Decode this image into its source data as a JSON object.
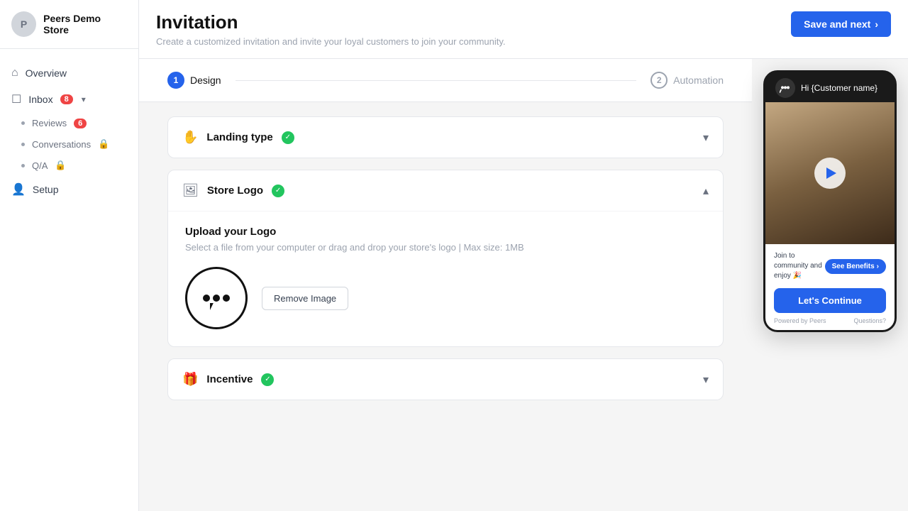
{
  "sidebar": {
    "store_name": "Peers Demo Store",
    "avatar_initials": "P",
    "nav_items": [
      {
        "id": "overview",
        "label": "Overview",
        "icon": "⌂",
        "badge": null,
        "locked": false
      },
      {
        "id": "inbox",
        "label": "Inbox",
        "icon": "☐",
        "badge": "8",
        "locked": false,
        "has_chevron": true
      },
      {
        "id": "reviews",
        "label": "Reviews",
        "icon": "•",
        "badge": "6",
        "locked": false,
        "sub": true
      },
      {
        "id": "conversations",
        "label": "Conversations",
        "icon": "•",
        "badge": null,
        "locked": true,
        "sub": true
      },
      {
        "id": "qa",
        "label": "Q/A",
        "icon": "•",
        "badge": null,
        "locked": true,
        "sub": true
      },
      {
        "id": "setup",
        "label": "Setup",
        "icon": "👤",
        "badge": null,
        "locked": false
      }
    ]
  },
  "header": {
    "title": "Invitation",
    "subtitle": "Create a customized invitation and invite your loyal customers to join your community.",
    "save_next_label": "Save and next",
    "save_next_arrow": "→"
  },
  "steps": [
    {
      "id": "design",
      "label": "Design",
      "number": "1",
      "active": true
    },
    {
      "id": "automation",
      "label": "Automation",
      "number": "2",
      "active": false
    }
  ],
  "sections": [
    {
      "id": "landing-type",
      "icon": "🖐",
      "title": "Landing type",
      "checked": true,
      "expanded": false
    },
    {
      "id": "store-logo",
      "icon": "🖼",
      "title": "Store Logo",
      "checked": true,
      "expanded": true,
      "upload_title": "Upload your Logo",
      "upload_subtitle": "Select a file from your computer or drag and drop your store's logo | Max size: 1MB",
      "remove_button_label": "Remove Image"
    },
    {
      "id": "incentive",
      "icon": "🎁",
      "title": "Incentive",
      "checked": true,
      "expanded": false
    }
  ],
  "preview": {
    "greeting": "Hi {Customer name}",
    "join_text": "Join to community and enjoy 🎉",
    "see_benefits_label": "See Benefits",
    "lets_continue_label": "Let's Continue",
    "powered_by": "Powered by Peers",
    "questions_label": "Questions?"
  },
  "colors": {
    "primary": "#2563eb",
    "success": "#22c55e",
    "danger": "#ef4444"
  }
}
